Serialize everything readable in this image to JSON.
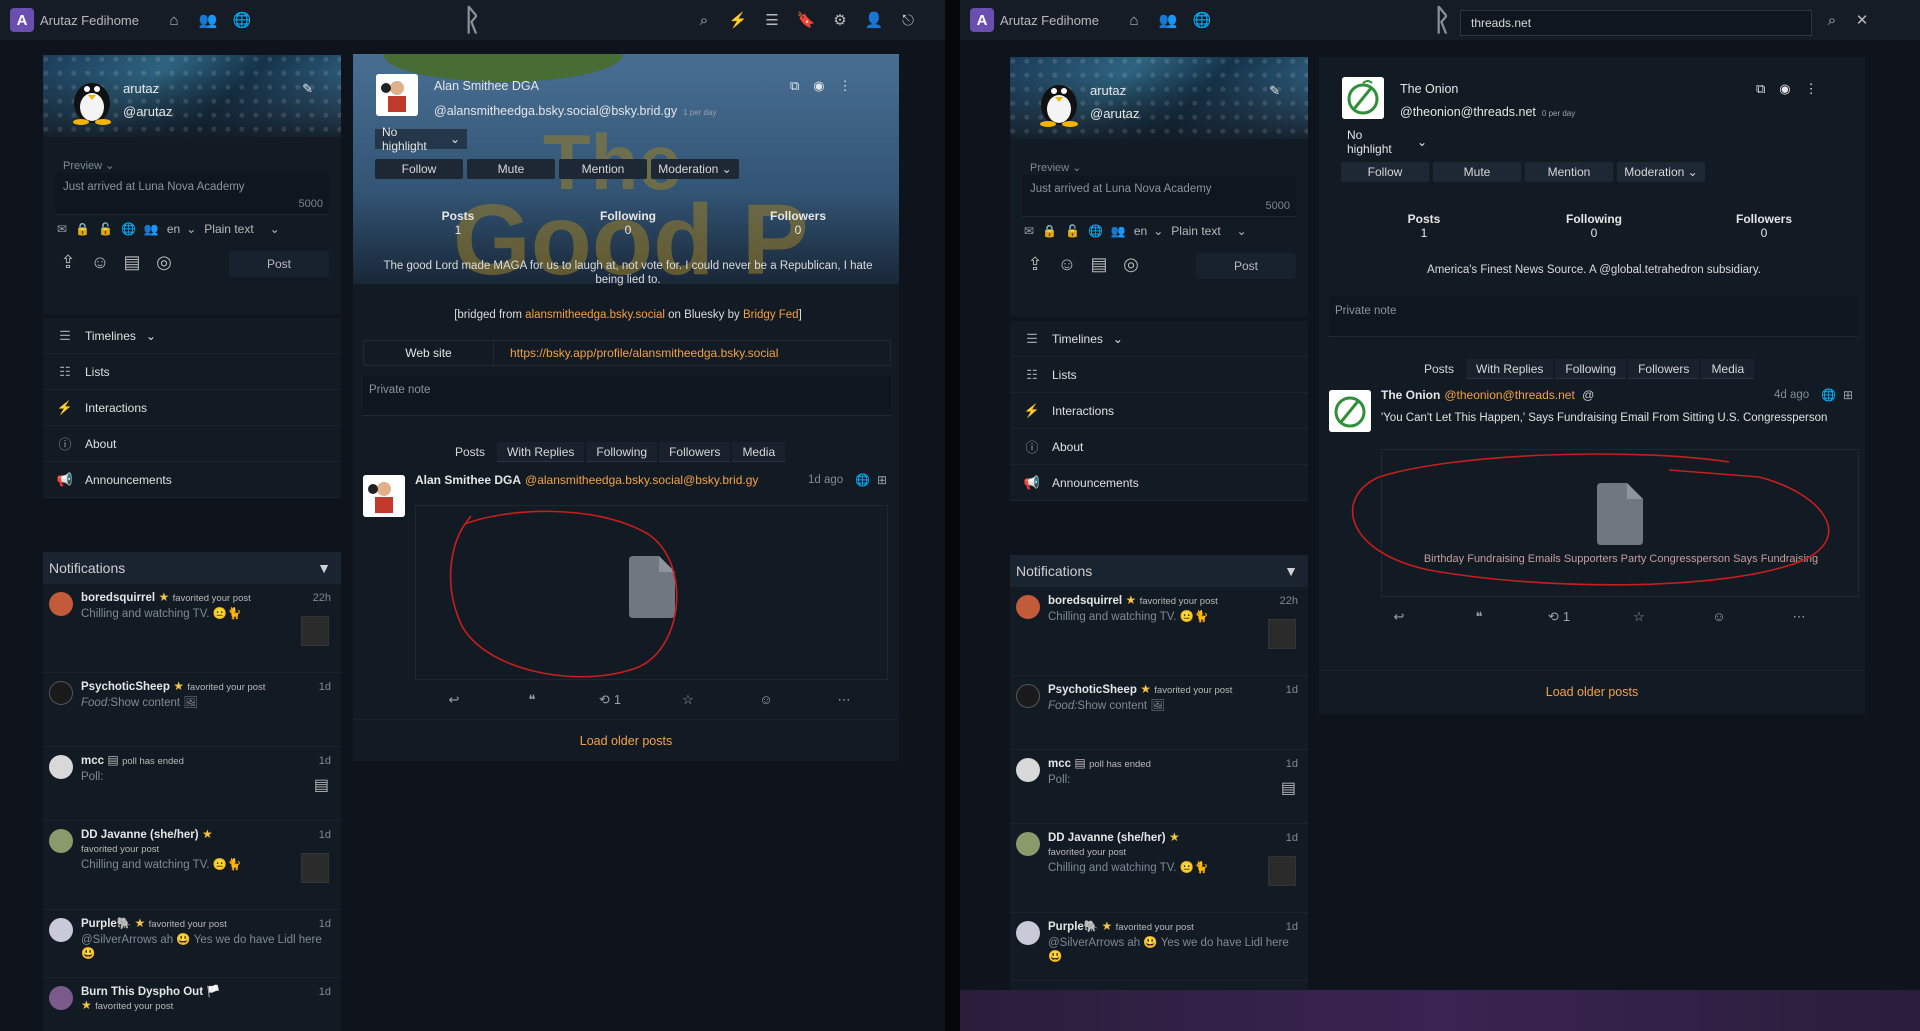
{
  "app": {
    "title": "Arutaz Fedihome"
  },
  "search": {
    "value": "threads.net"
  },
  "user": {
    "name": "arutaz",
    "handle": "@arutaz"
  },
  "postform": {
    "preview_label": "Preview",
    "placeholder": "Just arrived at Luna Nova Academy",
    "char_count": "5000",
    "language": "en",
    "content_type": "Plain text",
    "post_button": "Post"
  },
  "nav": {
    "timelines": "Timelines",
    "lists": "Lists",
    "interactions": "Interactions",
    "about": "About",
    "announcements": "Announcements"
  },
  "notifications": {
    "title": "Notifications",
    "items": [
      {
        "name": "boredsquirrel",
        "action": "favorited your post",
        "time": "22h",
        "text": "Chilling and watching TV. 😐🐈"
      },
      {
        "name": "PsychoticSheep",
        "action": "favorited your post",
        "time": "1d",
        "text_em": "Food:",
        "text": "Show content 🖼"
      },
      {
        "name": "mcc",
        "action": "poll has ended",
        "time": "1d",
        "text": "Poll:"
      },
      {
        "name": "DD Javanne (she/her)",
        "action": "favorited your post",
        "time": "1d",
        "text": "Chilling and watching TV. 😐🐈"
      },
      {
        "name": "Purple🐘",
        "action": "favorited your post",
        "time": "1d",
        "text": "@SilverArrows ah 😃 Yes we do have Lidl here 😃"
      },
      {
        "name": "Burn This Dyspho Out 🏳️",
        "action": "favorited your post",
        "time": "1d",
        "text": ""
      }
    ]
  },
  "profile_left": {
    "name": "Alan Smithee DGA",
    "handle": "@alansmitheedga.bsky.social@bsky.brid.gy",
    "rate": "1 per day",
    "highlight": "No highlight",
    "buttons": {
      "follow": "Follow",
      "mute": "Mute",
      "mention": "Mention",
      "moderation": "Moderation"
    },
    "stats": {
      "posts_label": "Posts",
      "posts": "1",
      "following_label": "Following",
      "following": "0",
      "followers_label": "Followers",
      "followers": "0"
    },
    "bio": "The good Lord made MAGA for us to laugh at, not vote for. I could never be a Republican, I hate being lied to.",
    "bridged_prefix": "[bridged from",
    "bridged_link": "alansmitheedga.bsky.social",
    "bridged_mid": "on Bluesky by",
    "bridged_by": "Bridgy Fed",
    "bridged_suffix": "]",
    "website_label": "Web site",
    "website": "https://bsky.app/profile/alansmitheedga.bsky.social",
    "note_placeholder": "Private note",
    "tabs": [
      "Posts",
      "With Replies",
      "Following",
      "Followers",
      "Media"
    ],
    "post": {
      "name": "Alan Smithee DGA",
      "handle": "@alansmitheedga.bsky.social@bsky.brid.gy",
      "time": "1d ago",
      "reblogs": "1"
    },
    "load_more": "Load older posts"
  },
  "profile_right": {
    "name": "The Onion",
    "handle": "@theonion@threads.net",
    "rate": "0 per day",
    "highlight": "No highlight",
    "buttons": {
      "follow": "Follow",
      "mute": "Mute",
      "mention": "Mention",
      "moderation": "Moderation"
    },
    "stats": {
      "posts_label": "Posts",
      "posts": "1",
      "following_label": "Following",
      "following": "0",
      "followers_label": "Followers",
      "followers": "0"
    },
    "bio": "America's Finest News Source. A @global.tetrahedron subsidiary.",
    "note_placeholder": "Private note",
    "tabs": [
      "Posts",
      "With Replies",
      "Following",
      "Followers",
      "Media"
    ],
    "post": {
      "name": "The Onion",
      "handle": "@theonion@threads.net",
      "time": "4d ago",
      "text": "'You Can't Let This Happen,' Says Fundraising Email From Sitting U.S. Congressperson",
      "attachment_caption": "Birthday Fundraising Emails Supporters Party Congressperson Says Fundraising",
      "reblogs": "1"
    },
    "load_more": "Load older posts"
  },
  "colors": {
    "accent": "#f5a142",
    "background": "#0f141c",
    "panel": "#121a24"
  }
}
